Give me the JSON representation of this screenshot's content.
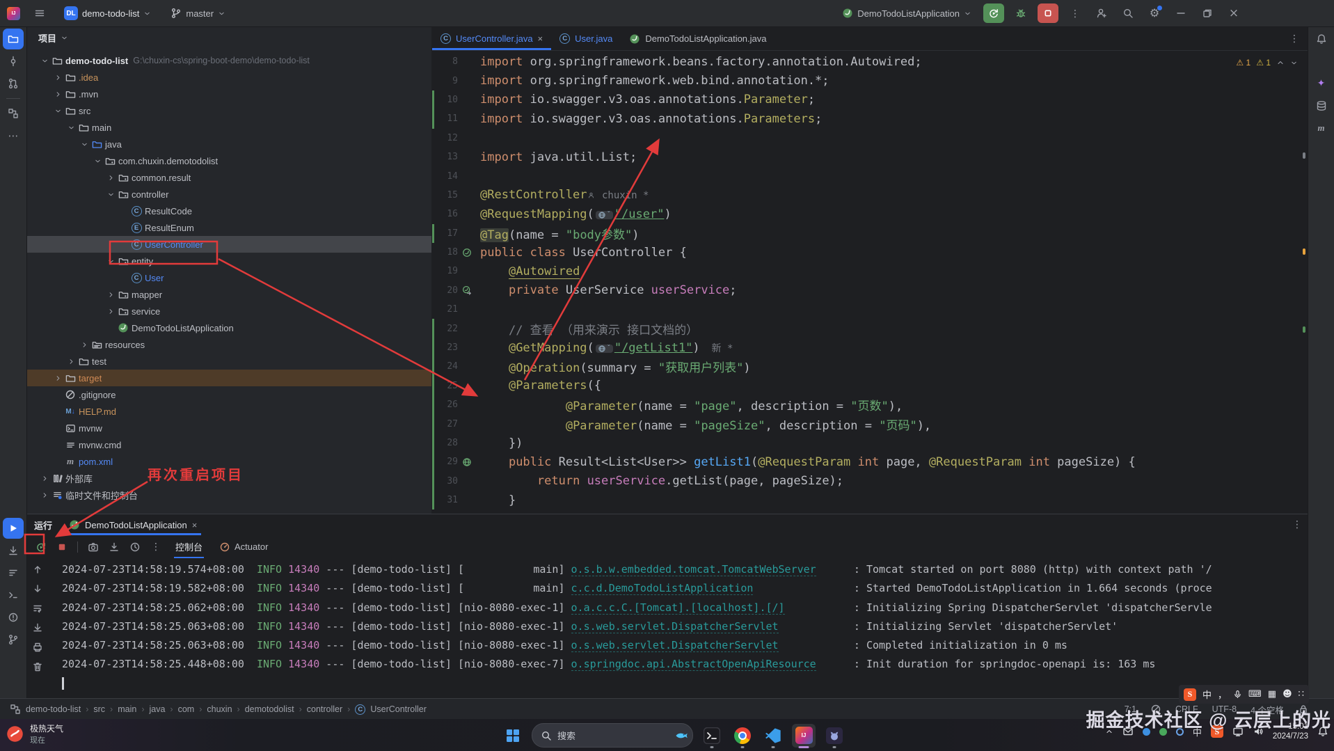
{
  "titlebar": {
    "project_name": "demo-todo-list",
    "project_badge": "DL",
    "branch": "master",
    "run_config": "DemoTodoListApplication"
  },
  "editor_tabs": [
    {
      "label": "UserController.java",
      "icon": "class",
      "modified": true,
      "active": true,
      "closable": true
    },
    {
      "label": "User.java",
      "icon": "class",
      "modified": true
    },
    {
      "label": "DemoTodoListApplication.java",
      "icon": "spring"
    }
  ],
  "inspections": {
    "warnings": "1",
    "weak_warnings": "1"
  },
  "project_panel": {
    "title": "项目",
    "tree": [
      {
        "d": 0,
        "ch": "v",
        "ic": "folder",
        "label": "demo-todo-list",
        "bold": true,
        "path": "G:\\chuxin-cs\\spring-boot-demo\\demo-todo-list"
      },
      {
        "d": 1,
        "ch": ">",
        "ic": "folder",
        "label": ".idea",
        "color": "ex"
      },
      {
        "d": 1,
        "ch": ">",
        "ic": "folder",
        "label": ".mvn"
      },
      {
        "d": 1,
        "ch": "v",
        "ic": "folder",
        "label": "src"
      },
      {
        "d": 2,
        "ch": "v",
        "ic": "folder",
        "label": "main"
      },
      {
        "d": 3,
        "ch": "v",
        "ic": "srcfolder",
        "label": "java"
      },
      {
        "d": 4,
        "ch": "v",
        "ic": "package",
        "label": "com.chuxin.demotodolist"
      },
      {
        "d": 5,
        "ch": ">",
        "ic": "package",
        "label": "common.result"
      },
      {
        "d": 5,
        "ch": "v",
        "ic": "package",
        "label": "controller"
      },
      {
        "d": 6,
        "ch": "",
        "ic": "class",
        "label": "ResultCode"
      },
      {
        "d": 6,
        "ch": "",
        "ic": "enum",
        "label": "ResultEnum"
      },
      {
        "d": 6,
        "ch": "",
        "ic": "class",
        "label": "UserController",
        "color": "mod",
        "selected": true
      },
      {
        "d": 5,
        "ch": "v",
        "ic": "package",
        "label": "entity"
      },
      {
        "d": 6,
        "ch": "",
        "ic": "class",
        "label": "User",
        "color": "mod"
      },
      {
        "d": 5,
        "ch": ">",
        "ic": "package",
        "label": "mapper"
      },
      {
        "d": 5,
        "ch": ">",
        "ic": "package",
        "label": "service"
      },
      {
        "d": 5,
        "ch": "",
        "ic": "spring",
        "label": "DemoTodoListApplication"
      },
      {
        "d": 3,
        "ch": ">",
        "ic": "resfolder",
        "label": "resources"
      },
      {
        "d": 2,
        "ch": ">",
        "ic": "folder",
        "label": "test"
      },
      {
        "d": 1,
        "ch": ">",
        "ic": "folder",
        "label": "target",
        "color": "ex2",
        "rowbg": true
      },
      {
        "d": 1,
        "ch": "",
        "ic": "ignore",
        "label": ".gitignore"
      },
      {
        "d": 1,
        "ch": "",
        "ic": "md",
        "label": "HELP.md",
        "color": "ex"
      },
      {
        "d": 1,
        "ch": "",
        "ic": "sh",
        "label": "mvnw"
      },
      {
        "d": 1,
        "ch": "",
        "ic": "lines",
        "label": "mvnw.cmd"
      },
      {
        "d": 1,
        "ch": "",
        "ic": "maven",
        "label": "pom.xml",
        "color": "mod"
      },
      {
        "d": 0,
        "ch": ">",
        "ic": "lib",
        "label": "外部库"
      },
      {
        "d": 0,
        "ch": ">",
        "ic": "scratch",
        "label": "临时文件和控制台"
      }
    ]
  },
  "editor": {
    "lines": [
      {
        "n": 8,
        "tok": [
          {
            "c": "k",
            "t": "import"
          },
          {
            "c": "p",
            "t": " org.springframework.beans.factory.annotation.Autowired;"
          }
        ]
      },
      {
        "n": 9,
        "tok": [
          {
            "c": "k",
            "t": "import"
          },
          {
            "c": "p",
            "t": " org.springframework.web.bind.annotation.*;"
          }
        ]
      },
      {
        "n": 10,
        "chg": true,
        "tok": [
          {
            "c": "k",
            "t": "import"
          },
          {
            "c": "p",
            "t": " io.swagger.v3.oas.annotations."
          },
          {
            "c": "a",
            "t": "Parameter"
          },
          {
            "c": "p",
            "t": ";"
          }
        ]
      },
      {
        "n": 11,
        "chg": true,
        "tok": [
          {
            "c": "k",
            "t": "import"
          },
          {
            "c": "p",
            "t": " io.swagger.v3.oas.annotations."
          },
          {
            "c": "a",
            "t": "Parameters"
          },
          {
            "c": "p",
            "t": ";"
          }
        ]
      },
      {
        "n": 12,
        "tok": []
      },
      {
        "n": 13,
        "tok": [
          {
            "c": "k",
            "t": "import"
          },
          {
            "c": "p",
            "t": " java.util.List;"
          }
        ]
      },
      {
        "n": 14,
        "tok": []
      },
      {
        "n": 15,
        "tok": [
          {
            "c": "a",
            "t": "@RestController"
          },
          {
            "w": "inlay",
            "person": true,
            "t": " chuxin *"
          }
        ]
      },
      {
        "n": 16,
        "tok": [
          {
            "c": "a",
            "t": "@RequestMapping"
          },
          {
            "c": "p",
            "t": "("
          },
          {
            "w": "globe"
          },
          {
            "c": "sl",
            "t": "\"/user\""
          },
          {
            "c": "p",
            "t": ")"
          }
        ]
      },
      {
        "n": 17,
        "chg": true,
        "tok": [
          {
            "c": "hl",
            "t": "@Tag"
          },
          {
            "c": "p",
            "t": "(name = "
          },
          {
            "c": "s",
            "t": "\"body参数\""
          },
          {
            "c": "p",
            "t": ")"
          }
        ]
      },
      {
        "n": 18,
        "gut": "bean",
        "tok": [
          {
            "c": "k",
            "t": "public class"
          },
          {
            "c": "p",
            "t": " UserController {"
          }
        ]
      },
      {
        "n": 19,
        "tok": [
          {
            "c": "p",
            "t": "    "
          },
          {
            "c": "au",
            "t": "@Autowired"
          }
        ]
      },
      {
        "n": 20,
        "gut": "beanarrow",
        "tok": [
          {
            "c": "p",
            "t": "    "
          },
          {
            "c": "k",
            "t": "private"
          },
          {
            "c": "p",
            "t": " UserService "
          },
          {
            "c": "f",
            "t": "userService"
          },
          {
            "c": "p",
            "t": ";"
          }
        ]
      },
      {
        "n": 21,
        "tok": []
      },
      {
        "n": 22,
        "chg": true,
        "tok": [
          {
            "c": "p",
            "t": "    "
          },
          {
            "c": "c",
            "t": "// 查看 （用来演示 接口文档的）"
          }
        ]
      },
      {
        "n": 23,
        "chg": true,
        "tok": [
          {
            "c": "p",
            "t": "    "
          },
          {
            "c": "a",
            "t": "@GetMapping"
          },
          {
            "c": "p",
            "t": "("
          },
          {
            "w": "globe"
          },
          {
            "c": "sl",
            "t": "\"/getList1\""
          },
          {
            "c": "p",
            "t": ")"
          },
          {
            "w": "inlay",
            "t": "  新 *"
          }
        ]
      },
      {
        "n": 24,
        "chg": true,
        "tok": [
          {
            "c": "p",
            "t": "    "
          },
          {
            "c": "a",
            "t": "@Operation"
          },
          {
            "c": "p",
            "t": "(summary = "
          },
          {
            "c": "s",
            "t": "\"获取用户列表\""
          },
          {
            "c": "p",
            "t": ")"
          }
        ]
      },
      {
        "n": 25,
        "chg": true,
        "tok": [
          {
            "c": "p",
            "t": "    "
          },
          {
            "c": "a",
            "t": "@Parameters"
          },
          {
            "c": "p",
            "t": "({"
          }
        ]
      },
      {
        "n": 26,
        "chg": true,
        "tok": [
          {
            "c": "p",
            "t": "            "
          },
          {
            "c": "a",
            "t": "@Parameter"
          },
          {
            "c": "p",
            "t": "(name = "
          },
          {
            "c": "s",
            "t": "\"page\""
          },
          {
            "c": "p",
            "t": ", description = "
          },
          {
            "c": "s",
            "t": "\"页数\""
          },
          {
            "c": "p",
            "t": "),"
          }
        ]
      },
      {
        "n": 27,
        "chg": true,
        "tok": [
          {
            "c": "p",
            "t": "            "
          },
          {
            "c": "a",
            "t": "@Parameter"
          },
          {
            "c": "p",
            "t": "(name = "
          },
          {
            "c": "s",
            "t": "\"pageSize\""
          },
          {
            "c": "p",
            "t": ", description = "
          },
          {
            "c": "s",
            "t": "\"页码\""
          },
          {
            "c": "p",
            "t": "),"
          }
        ]
      },
      {
        "n": 28,
        "chg": true,
        "tok": [
          {
            "c": "p",
            "t": "    })"
          }
        ]
      },
      {
        "n": 29,
        "chg": true,
        "gut": "api",
        "tok": [
          {
            "c": "p",
            "t": "    "
          },
          {
            "c": "k",
            "t": "public"
          },
          {
            "c": "p",
            "t": " Result<List<User>> "
          },
          {
            "c": "m",
            "t": "getList1"
          },
          {
            "c": "p",
            "t": "("
          },
          {
            "c": "a",
            "t": "@RequestParam"
          },
          {
            "c": "p",
            "t": " "
          },
          {
            "c": "k",
            "t": "int"
          },
          {
            "c": "p",
            "t": " page, "
          },
          {
            "c": "a",
            "t": "@RequestParam"
          },
          {
            "c": "p",
            "t": " "
          },
          {
            "c": "k",
            "t": "int"
          },
          {
            "c": "p",
            "t": " pageSize) {"
          }
        ]
      },
      {
        "n": 30,
        "chg": true,
        "tok": [
          {
            "c": "p",
            "t": "        "
          },
          {
            "c": "k",
            "t": "return"
          },
          {
            "c": "p",
            "t": " "
          },
          {
            "c": "f",
            "t": "userService"
          },
          {
            "c": "p",
            "t": ".getList(page, pageSize);"
          }
        ]
      },
      {
        "n": 31,
        "chg": true,
        "tok": [
          {
            "c": "p",
            "t": "    }"
          }
        ]
      }
    ]
  },
  "run_panel": {
    "label": "运行",
    "tab": "DemoTodoListApplication",
    "console_tab": "控制台",
    "actuator_tab": "Actuator",
    "console": [
      {
        "time": "2024-07-23T14:58:19.574+08:00",
        "level": "INFO",
        "pid": "14340",
        "app": "demo-todo-list",
        "thread": "           main",
        "logger": "o.s.b.w.embedded.tomcat.TomcatWebServer",
        "msg": ": Tomcat started on port 8080 (http) with context path '/"
      },
      {
        "time": "2024-07-23T14:58:19.582+08:00",
        "level": "INFO",
        "pid": "14340",
        "app": "demo-todo-list",
        "thread": "           main",
        "logger": "c.c.d.DemoTodoListApplication",
        "msg": ": Started DemoTodoListApplication in 1.664 seconds (proce"
      },
      {
        "time": "2024-07-23T14:58:25.062+08:00",
        "level": "INFO",
        "pid": "14340",
        "app": "demo-todo-list",
        "thread": "nio-8080-exec-1",
        "logger": "o.a.c.c.C.[Tomcat].[localhost].[/]",
        "msg": ": Initializing Spring DispatcherServlet 'dispatcherServle"
      },
      {
        "time": "2024-07-23T14:58:25.063+08:00",
        "level": "INFO",
        "pid": "14340",
        "app": "demo-todo-list",
        "thread": "nio-8080-exec-1",
        "logger": "o.s.web.servlet.DispatcherServlet",
        "msg": ": Initializing Servlet 'dispatcherServlet'"
      },
      {
        "time": "2024-07-23T14:58:25.063+08:00",
        "level": "INFO",
        "pid": "14340",
        "app": "demo-todo-list",
        "thread": "nio-8080-exec-1",
        "logger": "o.s.web.servlet.DispatcherServlet",
        "msg": ": Completed initialization in 0 ms"
      },
      {
        "time": "2024-07-23T14:58:25.448+08:00",
        "level": "INFO",
        "pid": "14340",
        "app": "demo-todo-list",
        "thread": "nio-8080-exec-7",
        "logger": "o.springdoc.api.AbstractOpenApiResource",
        "msg": ": Init duration for springdoc-openapi is: 163 ms"
      }
    ]
  },
  "status_bar": {
    "breadcrumbs": [
      "demo-todo-list",
      "src",
      "main",
      "java",
      "com",
      "chuxin",
      "demotodolist",
      "controller",
      "UserController"
    ],
    "position": "7:1",
    "line_ending": "CRLF",
    "encoding": "UTF-8",
    "indent": "4 个空格"
  },
  "taskbar": {
    "weather_line1": "极热天气",
    "weather_line2": "现在",
    "search_placeholder": "搜索",
    "lang_indicator": "中",
    "time": "15:01",
    "date": "2024/7/23"
  },
  "annotations": {
    "note": "再次重启项目"
  },
  "watermark": "掘金技术社区 @ 云层上的光",
  "stripes": {
    "left_top": [
      "project-folder",
      "commit",
      "pull-request",
      "structure",
      "more"
    ],
    "left_bottom": [
      "run",
      "step-down",
      "sort-lines",
      "terminal",
      "problems",
      "git-branch"
    ],
    "right": [
      "notifications",
      "ai-assistant",
      "database",
      "maven"
    ]
  },
  "colors": {
    "accent_blue": "#3574f0",
    "modified_blue": "#548af7",
    "annotation_red": "#e23b3b",
    "run_green": "#549159",
    "stop_red": "#c75450",
    "string_green": "#6aab73",
    "keyword_orange": "#cf8e6d",
    "logger_teal": "#299b9b",
    "pid_purple": "#c77dbb"
  }
}
